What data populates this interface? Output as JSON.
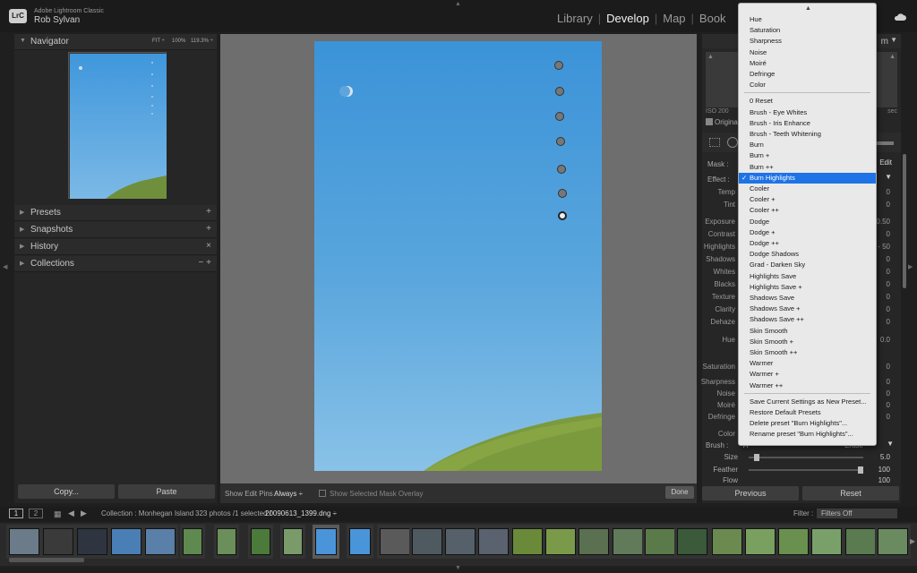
{
  "app": {
    "badge": "LrC",
    "name": "Adobe Lightroom Classic",
    "user": "Rob Sylvan"
  },
  "modules": [
    {
      "label": "Library",
      "active": false
    },
    {
      "label": "Develop",
      "active": true
    },
    {
      "label": "Map",
      "active": false
    },
    {
      "label": "Book",
      "active": false
    }
  ],
  "navigator": {
    "title": "Navigator",
    "zoom_fit": "FIT ÷",
    "zoom_100": "100%",
    "zoom_other": "119.3% ÷"
  },
  "left_sections": [
    {
      "label": "Presets",
      "action": "+"
    },
    {
      "label": "Snapshots",
      "action": "+"
    },
    {
      "label": "History",
      "action": "×"
    },
    {
      "label": "Collections",
      "action": "− +"
    }
  ],
  "left_buttons": {
    "copy": "Copy...",
    "paste": "Paste"
  },
  "center_toolbar": {
    "show_edit_pins_label": "Show Edit Pins :",
    "show_edit_pins_value": "Always ÷",
    "show_mask_overlay": "Show Selected Mask Overlay",
    "done": "Done"
  },
  "histogram": {
    "iso": "ISO 200",
    "shutter": "sec",
    "original": "Original",
    "corner": "m"
  },
  "mask": {
    "label": "Mask :",
    "edit": "Edit"
  },
  "effect": {
    "label": "Effect :"
  },
  "sliders": [
    {
      "label": "Temp",
      "value": "0"
    },
    {
      "label": "Tint",
      "value": "0"
    },
    {
      "label": "Exposure",
      "value": "0.50"
    },
    {
      "label": "Contrast",
      "value": "0"
    },
    {
      "label": "Highlights",
      "value": "- 50"
    },
    {
      "label": "Shadows",
      "value": "0"
    },
    {
      "label": "Whites",
      "value": "0"
    },
    {
      "label": "Blacks",
      "value": "0"
    },
    {
      "label": "Texture",
      "value": "0"
    },
    {
      "label": "Clarity",
      "value": "0"
    },
    {
      "label": "Dehaze",
      "value": "0"
    },
    {
      "label": "Hue",
      "value": "0.0"
    },
    {
      "label": "Saturation",
      "value": "0"
    },
    {
      "label": "Sharpness",
      "value": "0"
    },
    {
      "label": "Noise",
      "value": "0"
    },
    {
      "label": "Moiré",
      "value": "0"
    },
    {
      "label": "Defringe",
      "value": "0"
    },
    {
      "label": "Color",
      "value": ""
    }
  ],
  "brush": {
    "label": "Brush :",
    "a_label": "A",
    "erase_label": "Erase",
    "size_label": "Size",
    "size_value": "5.0",
    "size_level": 0.05,
    "feather_label": "Feather",
    "feather_value": "100",
    "feather_level": 1.0,
    "flow_label": "Flow",
    "flow_value": "100"
  },
  "right_buttons": {
    "previous": "Previous",
    "reset": "Reset"
  },
  "dropdown": {
    "group1": [
      "Hue",
      "Saturation",
      "Sharpness",
      "Noise",
      "Moiré",
      "Defringe",
      "Color"
    ],
    "group2": [
      "0 Reset",
      "Brush - Eye Whites",
      "Brush - Iris Enhance",
      "Brush - Teeth Whitening",
      "Burn",
      "Burn +",
      "Burn ++",
      "Burn Highlights",
      "Cooler",
      "Cooler +",
      "Cooler ++",
      "Dodge",
      "Dodge +",
      "Dodge ++",
      "Dodge Shadows",
      "Grad - Darken Sky",
      "Highlights Save",
      "Highlights Save +",
      "Shadows Save",
      "Shadows Save +",
      "Shadows Save ++",
      "Skin Smooth",
      "Skin Smooth +",
      "Skin Smooth ++",
      "Warmer",
      "Warmer +",
      "Warmer ++"
    ],
    "selected": "Burn Highlights",
    "checkmark": "✓",
    "group3": [
      "Save Current Settings as New Preset...",
      "Restore Default Presets",
      "Delete preset \"Burn Highlights\"...",
      "Rename preset \"Burn Highlights\"..."
    ]
  },
  "filmbar": {
    "page1": "1",
    "page2": "2",
    "collection": "Collection : Monhegan Island",
    "count": "323 photos /1 selected /",
    "filename": "20090613_1399.dng ÷",
    "filter_label": "Filter :",
    "filter_value": "Filters Off"
  },
  "colors": {
    "accent": "#1f73e6",
    "panel": "#262626",
    "bg": "#1f1f1f"
  }
}
